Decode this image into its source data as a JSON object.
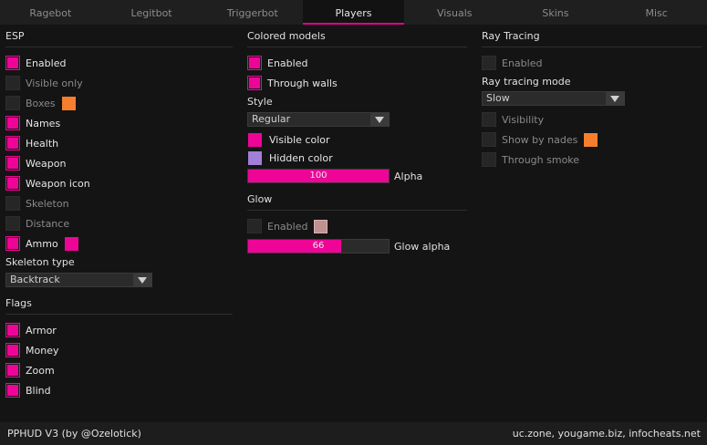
{
  "tabs": [
    "Ragebot",
    "Legitbot",
    "Triggerbot",
    "Players",
    "Visuals",
    "Skins",
    "Misc"
  ],
  "active_tab": "Players",
  "colors": {
    "accent": "#ee0597",
    "orange": "#f57f2e",
    "hidden": "#a27fd9",
    "glow": "#bf9191"
  },
  "esp": {
    "title": "ESP",
    "items": [
      {
        "label": "Enabled",
        "checked": true
      },
      {
        "label": "Visible only",
        "checked": false
      },
      {
        "label": "Boxes",
        "checked": false,
        "swatch": "#f57f2e"
      },
      {
        "label": "Names",
        "checked": true
      },
      {
        "label": "Health",
        "checked": true
      },
      {
        "label": "Weapon",
        "checked": true
      },
      {
        "label": "Weapon icon",
        "checked": true
      },
      {
        "label": "Skeleton",
        "checked": false
      },
      {
        "label": "Distance",
        "checked": false
      },
      {
        "label": "Ammo",
        "checked": true,
        "swatch": "#ee0597"
      }
    ],
    "skeleton_type_label": "Skeleton type",
    "skeleton_type_value": "Backtrack"
  },
  "flags": {
    "title": "Flags",
    "items": [
      {
        "label": "Armor",
        "checked": true
      },
      {
        "label": "Money",
        "checked": true
      },
      {
        "label": "Zoom",
        "checked": true
      },
      {
        "label": "Blind",
        "checked": true
      }
    ]
  },
  "colored_models": {
    "title": "Colored models",
    "items": [
      {
        "label": "Enabled",
        "checked": true
      },
      {
        "label": "Through walls",
        "checked": true
      }
    ],
    "style_label": "Style",
    "style_value": "Regular",
    "visible_color_label": "Visible color",
    "hidden_color_label": "Hidden color",
    "alpha_label": "Alpha",
    "alpha_value": "100",
    "alpha_fraction": 1.0
  },
  "glow": {
    "title": "Glow",
    "enabled_label": "Enabled",
    "enabled_checked": false,
    "alpha_label": "Glow alpha",
    "alpha_value": "66",
    "alpha_fraction": 0.66
  },
  "ray_tracing": {
    "title": "Ray Tracing",
    "enabled_label": "Enabled",
    "mode_label": "Ray tracing mode",
    "mode_value": "Slow",
    "items": [
      {
        "label": "Visibility",
        "checked": false
      },
      {
        "label": "Show by nades",
        "checked": false,
        "swatch": "#f57f2e"
      },
      {
        "label": "Through smoke",
        "checked": false
      }
    ]
  },
  "footer": {
    "left": "PPHUD V3 (by @Ozelotick)",
    "right": "uc.zone, yougame.biz, infocheats.net"
  }
}
